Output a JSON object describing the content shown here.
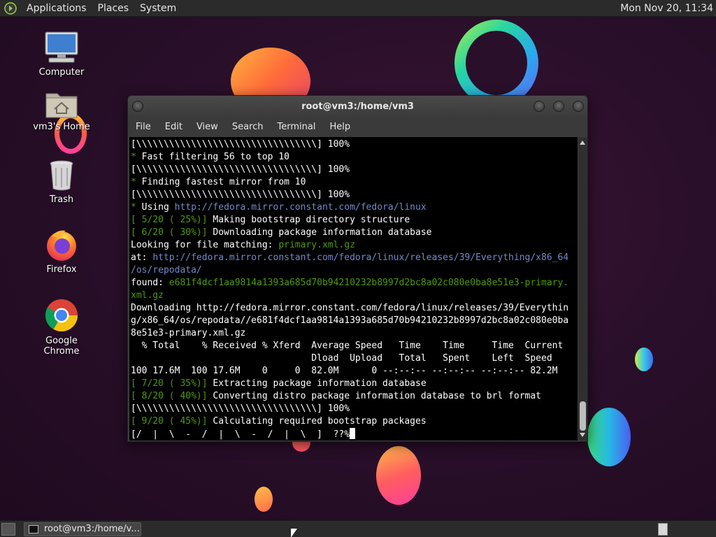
{
  "top_panel": {
    "menus": [
      "Applications",
      "Places",
      "System"
    ],
    "clock": "Mon Nov 20, 11:34"
  },
  "desktop_icons": [
    {
      "label": "Computer",
      "icon": "computer-icon"
    },
    {
      "label": "vm3's Home",
      "icon": "home-folder-icon"
    },
    {
      "label": "Trash",
      "icon": "trash-icon"
    },
    {
      "label": "Firefox",
      "icon": "firefox-icon"
    },
    {
      "label": "Google Chrome",
      "icon": "chrome-icon"
    }
  ],
  "terminal": {
    "title": "root@vm3:/home/vm3",
    "menu": [
      "File",
      "Edit",
      "View",
      "Search",
      "Terminal",
      "Help"
    ],
    "lines": [
      [
        {
          "t": "[\\\\\\\\\\\\\\\\\\\\\\\\\\\\\\\\\\\\\\\\\\\\\\\\\\\\\\\\\\\\\\\\\\] 100%",
          "c": ""
        }
      ],
      [
        {
          "t": "* ",
          "c": "green"
        },
        {
          "t": "Fast filtering 56 to top 10",
          "c": ""
        }
      ],
      [
        {
          "t": "[\\\\\\\\\\\\\\\\\\\\\\\\\\\\\\\\\\\\\\\\\\\\\\\\\\\\\\\\\\\\\\\\\\] 100%",
          "c": ""
        }
      ],
      [
        {
          "t": "* ",
          "c": "green"
        },
        {
          "t": "Finding fastest mirror from 10",
          "c": ""
        }
      ],
      [
        {
          "t": "[\\\\\\\\\\\\\\\\\\\\\\\\\\\\\\\\\\\\\\\\\\\\\\\\\\\\\\\\\\\\\\\\\\] 100%",
          "c": ""
        }
      ],
      [
        {
          "t": "* ",
          "c": "green"
        },
        {
          "t": "Using ",
          "c": ""
        },
        {
          "t": "http://fedora.mirror.constant.com/fedora/linux",
          "c": "blue"
        }
      ],
      [
        {
          "t": "[ 5/20 ( 25%)] ",
          "c": "green"
        },
        {
          "t": "Making bootstrap directory structure",
          "c": ""
        }
      ],
      [
        {
          "t": "[ 6/20 ( 30%)] ",
          "c": "green"
        },
        {
          "t": "Downloading package information database",
          "c": ""
        }
      ],
      [
        {
          "t": "Looking for file matching: ",
          "c": ""
        },
        {
          "t": "primary.xml.gz",
          "c": "green"
        }
      ],
      [
        {
          "t": "at: ",
          "c": ""
        },
        {
          "t": "http://fedora.mirror.constant.com/fedora/linux/releases/39/Everything/x86_64",
          "c": "blue"
        }
      ],
      [
        {
          "t": "/os/repodata/",
          "c": "blue"
        }
      ],
      [
        {
          "t": "found: ",
          "c": ""
        },
        {
          "t": "e681f4dcf1aa9814a1393a685d70b94210232b8997d2bc8a02c080e0ba8e51e3-primary.",
          "c": "green"
        }
      ],
      [
        {
          "t": "xml.gz",
          "c": "green"
        }
      ],
      [
        {
          "t": "Downloading http://fedora.mirror.constant.com/fedora/linux/releases/39/Everythin",
          "c": ""
        }
      ],
      [
        {
          "t": "g/x86_64/os/repodata//e681f4dcf1aa9814a1393a685d70b94210232b8997d2bc8a02c080e0ba",
          "c": ""
        }
      ],
      [
        {
          "t": "8e51e3-primary.xml.gz",
          "c": ""
        }
      ],
      [
        {
          "t": "  % Total    % Received % Xferd  Average Speed   Time    Time     Time  Current",
          "c": ""
        }
      ],
      [
        {
          "t": "                                 Dload  Upload   Total   Spent    Left  Speed",
          "c": ""
        }
      ],
      [
        {
          "t": "100 17.6M  100 17.6M    0     0  82.0M      0 --:--:-- --:--:-- --:--:-- 82.2M",
          "c": ""
        }
      ],
      [
        {
          "t": "[ 7/20 ( 35%)] ",
          "c": "green"
        },
        {
          "t": "Extracting package information database",
          "c": ""
        }
      ],
      [
        {
          "t": "[ 8/20 ( 40%)] ",
          "c": "green"
        },
        {
          "t": "Converting distro package information database to brl format",
          "c": ""
        }
      ],
      [
        {
          "t": "[\\\\\\\\\\\\\\\\\\\\\\\\\\\\\\\\\\\\\\\\\\\\\\\\\\\\\\\\\\\\\\\\\\] 100%",
          "c": ""
        }
      ],
      [
        {
          "t": "[ 9/20 ( 45%)] ",
          "c": "green"
        },
        {
          "t": "Calculating required bootstrap packages",
          "c": ""
        }
      ],
      [
        {
          "t": "[/  |  \\  -  /  |  \\  -  /  |  \\  ]  ??%",
          "c": ""
        }
      ]
    ]
  },
  "taskbar": {
    "task_label": "root@vm3:/home/v..."
  }
}
